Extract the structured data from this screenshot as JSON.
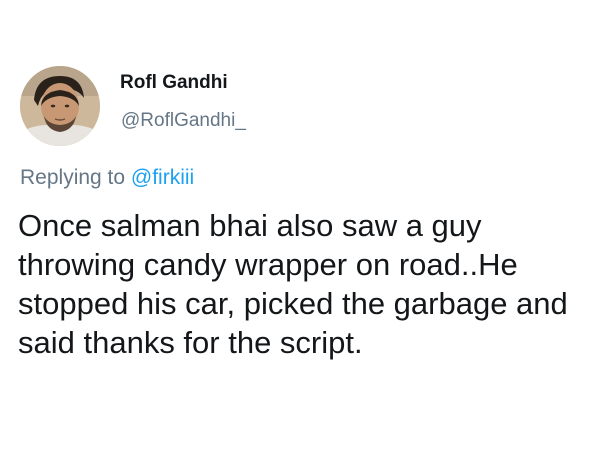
{
  "tweet": {
    "author": {
      "display_name": "Rofl Gandhi",
      "handle": "@RoflGandhi_",
      "avatar_icon": "profile-photo-avatar"
    },
    "reply": {
      "prefix": "Replying to ",
      "mention": "@firkiii"
    },
    "text": "Once salman bhai also saw a guy throwing candy wrapper on road..He stopped his car, picked the garbage and said thanks for the script."
  },
  "colors": {
    "text_primary": "#14171a",
    "text_secondary": "#657786",
    "link": "#1da1f2",
    "background": "#ffffff"
  }
}
